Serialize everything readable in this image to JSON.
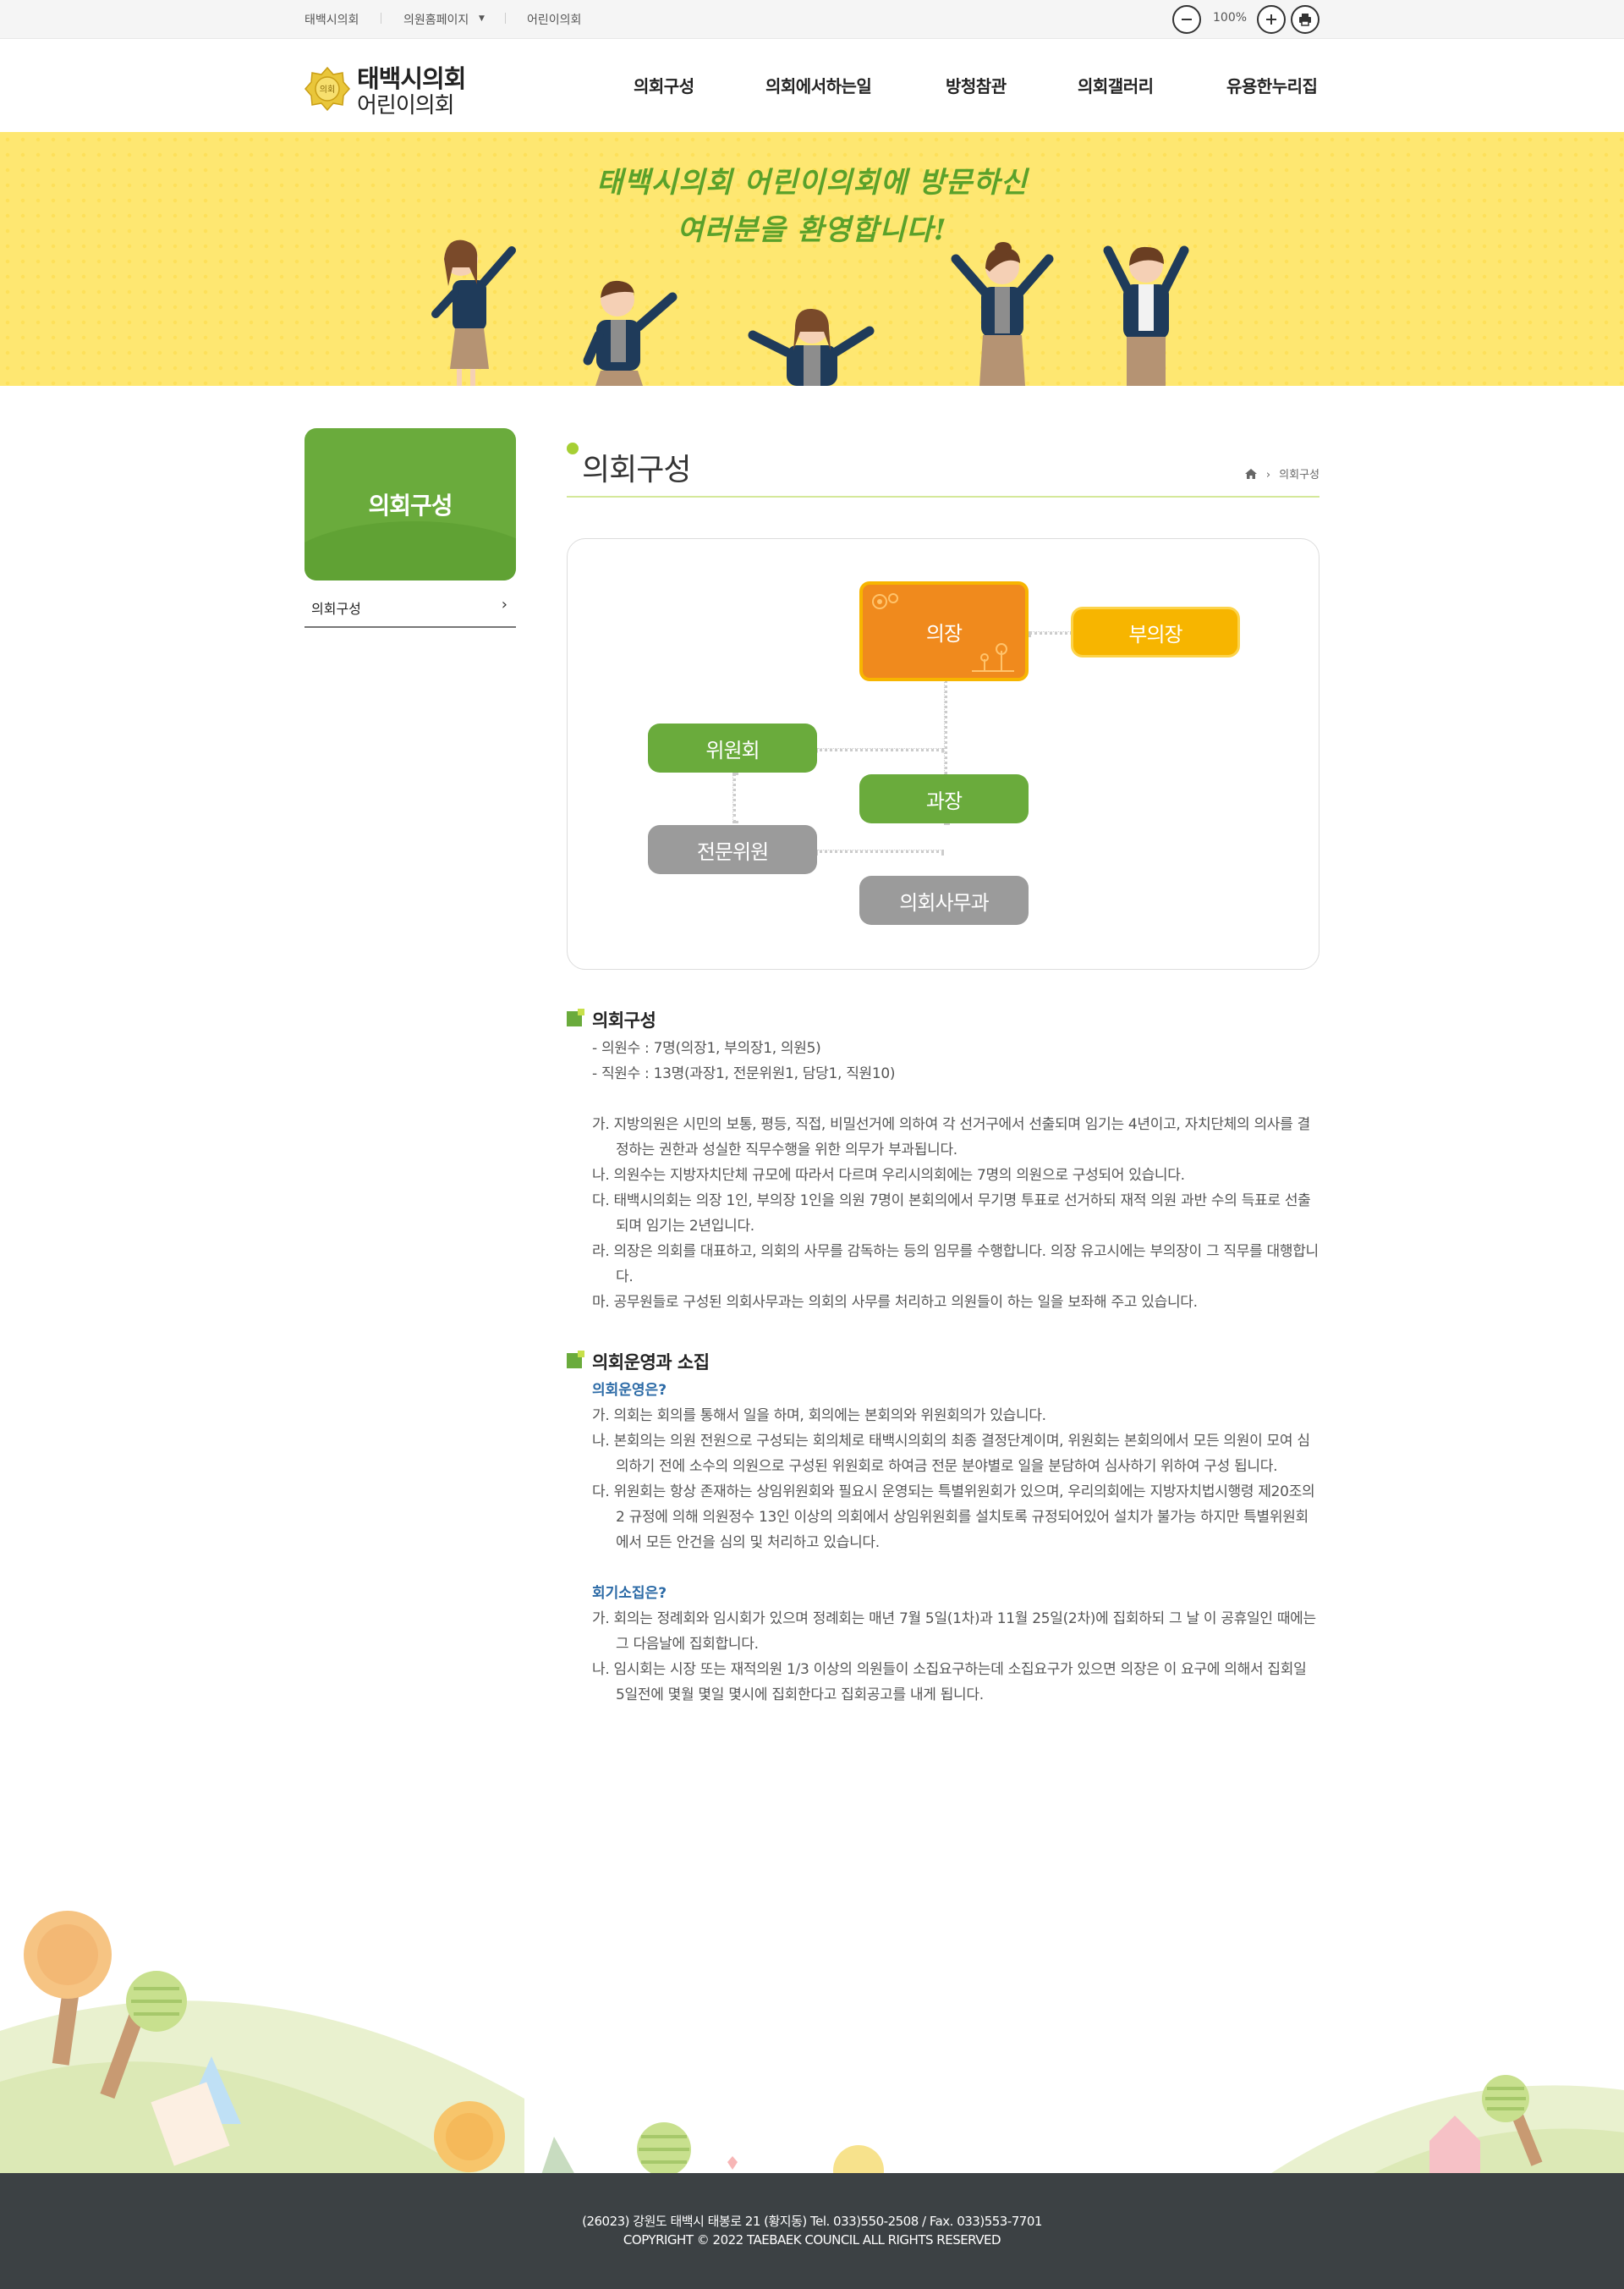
{
  "topbar": {
    "links": [
      "태백시의회",
      "의원홈페이지",
      "어린이의회"
    ],
    "zoom_value": "100%",
    "zoom_out_icon": "minus-icon",
    "zoom_in_icon": "plus-icon",
    "print_icon": "print-icon"
  },
  "header": {
    "logo_line1": "태백시의회",
    "logo_line2": "어린이의회",
    "emblem_text": "의회",
    "nav": [
      "의회구성",
      "의회에서하는일",
      "방청참관",
      "의회갤러리",
      "유용한누리집"
    ]
  },
  "banner": {
    "line1": "태백시의회 어린이의회에 방문하신",
    "line2": "여러분을 환영합니다!"
  },
  "sidebar": {
    "title": "의회구성",
    "items": [
      {
        "label": "의회구성",
        "icon": "chevron-right-icon"
      }
    ]
  },
  "page": {
    "title": "의회구성",
    "breadcrumb_icon": "home-icon",
    "breadcrumb": "의회구성"
  },
  "org": {
    "chair": "의장",
    "vice_chair": "부의장",
    "committee": "위원회",
    "section_chief": "과장",
    "specialist": "전문위원",
    "secretariat": "의회사무과",
    "colors": {
      "orange": "#f08a1d",
      "yellow": "#f7b500",
      "green": "#6aab3c",
      "gray": "#9b9b9b"
    }
  },
  "section1": {
    "heading": "의회구성",
    "summary": [
      "- 의원수 : 7명(의장1, 부의장1, 의원5)",
      "- 직원수 : 13명(과장1, 전문위원1, 담당1, 직원10)"
    ],
    "items": [
      "가. 지방의원은 시민의 보통, 평등, 직접, 비밀선거에 의하여 각 선거구에서 선출되며 임기는 4년이고, 자치단체의 의사를 결정하는 권한과 성실한 직무수행을 위한 의무가 부과됩니다.",
      "나. 의원수는 지방자치단체 규모에 따라서 다르며 우리시의회에는 7명의 의원으로 구성되어 있습니다.",
      "다. 태백시의회는 의장 1인, 부의장 1인을 의원 7명이 본회의에서 무기명 투표로 선거하되 재적 의원 과반 수의 득표로 선출되며 임기는 2년입니다.",
      "라. 의장은 의회를 대표하고, 의회의 사무를 감독하는 등의 임무를 수행합니다. 의장 유고시에는 부의장이 그 직무를 대행합니다.",
      "마. 공무원들로 구성된 의회사무과는 의회의 사무를 처리하고 의원들이 하는 일을 보좌해 주고 있습니다."
    ]
  },
  "section2": {
    "heading": "의회운영과 소집",
    "sub1": "의회운영은?",
    "items1": [
      "가. 의회는 회의를 통해서 일을 하며, 회의에는 본회의와 위원회의가 있습니다.",
      "나. 본회의는 의원 전원으로 구성되는 회의체로 태백시의회의 최종 결정단계이며, 위원회는 본회의에서 모든 의원이 모여 심의하기 전에 소수의 의원으로 구성된 위원회로 하여금 전문 분야별로 일을 분담하여 심사하기 위하여 구성 됩니다.",
      "다. 위원회는 항상 존재하는 상임위원회와 필요시 운영되는 특별위원회가 있으며, 우리의회에는 지방자치법시행령 제20조의2 규정에 의해 의원정수 13인 이상의 의회에서 상임위원회를 설치토록 규정되어있어 설치가 불가능 하지만 특별위원회에서 모든 안건을 심의 및 처리하고 있습니다."
    ],
    "sub2": "회기소집은?",
    "items2": [
      "가. 회의는 정례회와 임시회가 있으며 정례회는 매년 7월 5일(1차)과 11월 25일(2차)에 집회하되 그 날 이 공휴일인 때에는 그 다음날에 집회합니다.",
      "나. 임시회는 시장 또는 재적의원 1/3 이상의 의원들이 소집요구하는데 소집요구가 있으면 의장은 이 요구에 의해서 집회일 5일전에 몇월 몇일 몇시에 집회한다고 집회공고를 내게 됩니다."
    ]
  },
  "footer": {
    "address": "(26023) 강원도 태백시 태봉로 21 (황지동) Tel. 033)550-2508 / Fax. 033)553-7701",
    "copyright": "COPYRIGHT © 2022 TAEBAEK COUNCIL ALL RIGHTS RESERVED"
  }
}
